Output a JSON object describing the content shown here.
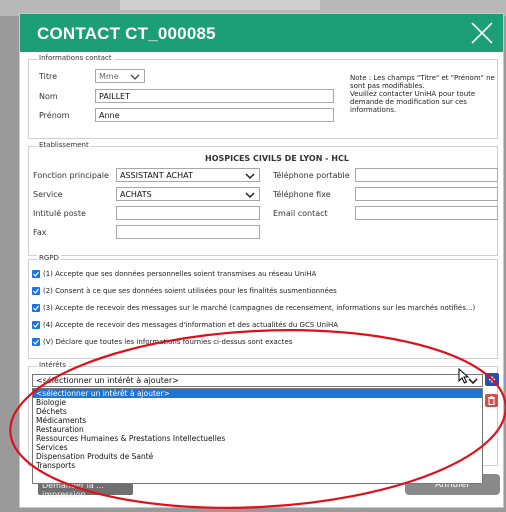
{
  "dialog": {
    "title": "CONTACT CT_000085"
  },
  "informations": {
    "legend": "Informations contact",
    "titre_label": "Titre",
    "titre_value": "Mme",
    "nom_label": "Nom",
    "nom_value": "PAILLET",
    "prenom_label": "Prénom",
    "prenom_value": "Anne",
    "note": [
      "Note : Les champs \"Titre\" et \"Prénom\" ne",
      "sont pas modifiables.",
      "Veuillez contacter UniHA pour toute",
      "demande de modification sur ces",
      "informations."
    ]
  },
  "etablissement": {
    "legend": "Etablissement",
    "name": "HOSPICES CIVILS DE LYON - HCL",
    "fonction_label": "Fonction principale",
    "fonction_value": "ASSISTANT ACHAT",
    "service_label": "Service",
    "service_value": "ACHATS",
    "intitule_label": "Intitulé poste",
    "fax_label": "Fax",
    "tel_portable_label": "Téléphone portable",
    "tel_fixe_label": "Téléphone fixe",
    "email_label": "Email contact"
  },
  "rgpd": {
    "legend": "RGPD",
    "items": [
      "(1) Accepte que ses données personnelles soient transmises au réseau UniHA",
      "(2) Consent à ce que ses données soient utilisées pour les finalités susmentionnées",
      "(3) Accepte de recevoir des messages sur le marché (campagnes de recensement, informations sur les marchés notifiés...)",
      "(4) Accepte de recevoir des messages d'information et des actualités du GCS UniHA",
      "(V) Déclare que toutes les informations fournies ci-dessus sont exactes"
    ]
  },
  "interets": {
    "legend": "Intérêts",
    "selected": "<sélectionner un intérêt à ajouter>",
    "options": [
      "<sélectionner un intérêt à ajouter>",
      "Biologie",
      "Déchets",
      "Médicaments",
      "Restauration",
      "Ressources Humaines & Prestations Intellectuelles",
      "Services",
      "Dispensation Produits de Santé",
      "Transports"
    ]
  },
  "footer": {
    "print_label": "Demander la ... impression",
    "cancel_label": "Annuler"
  },
  "colors": {
    "title_bar": "#1c9e76",
    "checkbox": "#1a73e8",
    "highlight": "#1e74d8",
    "annotation": "#e0101a"
  }
}
